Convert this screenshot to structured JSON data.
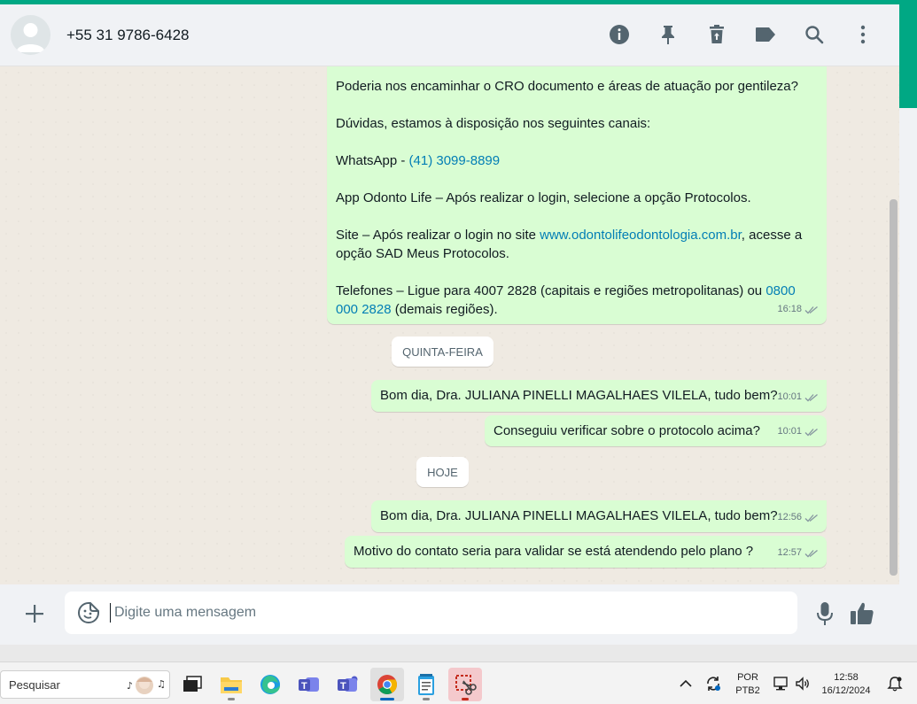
{
  "header": {
    "contact_name": "+55 31 9786-6428",
    "icons": [
      "info-icon",
      "pin-icon",
      "delete-icon",
      "label-icon",
      "search-icon",
      "menu-icon"
    ]
  },
  "messages": {
    "m1": {
      "p1": "Poderia nos encaminhar o CRO documento e áreas de atuação por gentileza?",
      "p2": "Dúvidas, estamos à disposição nos seguintes canais:",
      "p3_text": "WhatsApp - ",
      "p3_link": "(41) 3099-8899",
      "p4": "App Odonto Life – Após realizar o login, selecione a opção Protocolos.",
      "p5_a": "Site – Após realizar o login no site ",
      "p5_link": "www.odontolifeodontologia.com.br",
      "p5_b": ", acesse a opção SAD Meus Protocolos.",
      "p6_a": "Telefones – Ligue para 4007 2828 (capitais e regiões metropolitanas) ou ",
      "p6_link": "0800 000 2828",
      "p6_b": " (demais regiões).",
      "time": "16:18"
    },
    "day1": "QUINTA-FEIRA",
    "m2": {
      "text": "Bom dia, Dra. JULIANA PINELLI MAGALHAES VILELA, tudo bem?",
      "time": "10:01"
    },
    "m3": {
      "text": "Conseguiu verificar sobre o protocolo acima?",
      "time": "10:01"
    },
    "day2": "HOJE",
    "m4": {
      "text": "Bom dia, Dra. JULIANA PINELLI MAGALHAES VILELA, tudo bem?",
      "time": "12:56"
    },
    "m5": {
      "text": "Motivo do contato seria para validar se está atendendo pelo plano ?",
      "time": "12:57"
    }
  },
  "compose": {
    "placeholder": "Digite uma mensagem"
  },
  "taskbar": {
    "search_label": "Pesquisar",
    "apps": [
      "task-view",
      "file-explorer",
      "edge",
      "teams",
      "teams-classic",
      "chrome",
      "notepad",
      "snipping-tool"
    ],
    "lang_top": "POR",
    "lang_bottom": "PTB2",
    "time": "12:58",
    "date": "16/12/2024"
  },
  "colors": {
    "accent": "#00a884",
    "outgoing_bubble": "#d9fdd3",
    "link": "#027eb5",
    "header_bg": "#f0f2f5"
  }
}
